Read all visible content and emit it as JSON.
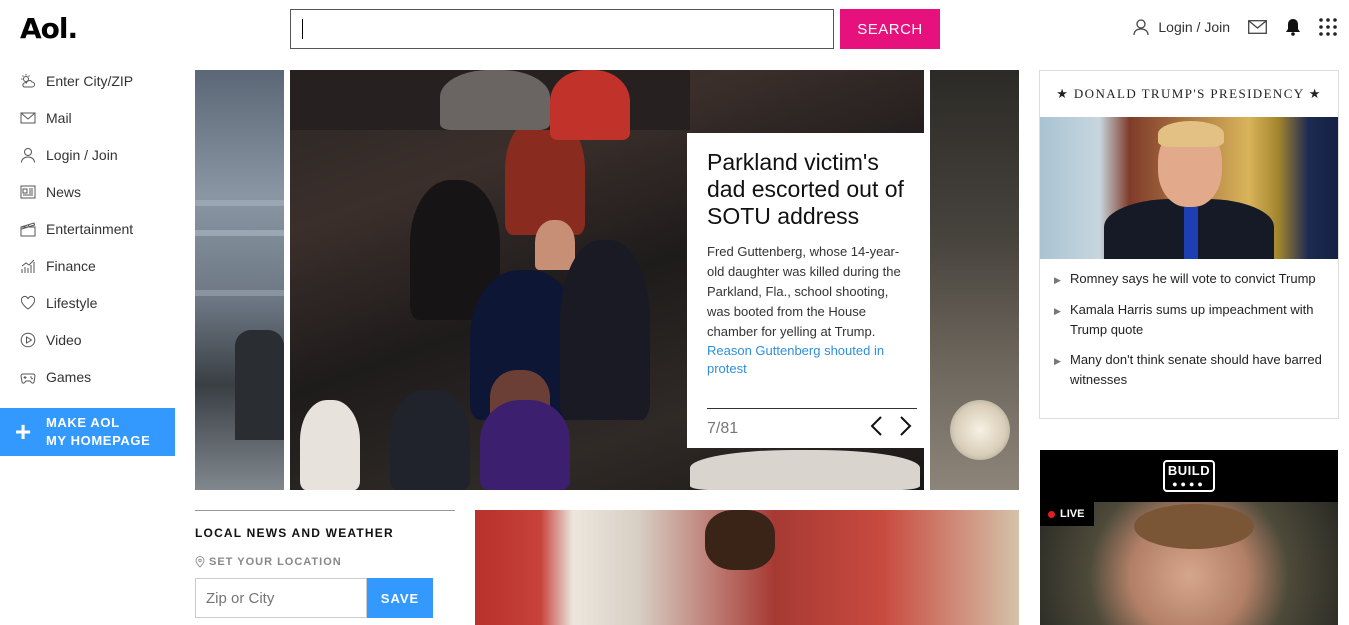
{
  "header": {
    "logo": "Aol.",
    "search_placeholder": "",
    "search_button": "SEARCH",
    "login_label": "Login / Join"
  },
  "leftnav": {
    "items": [
      {
        "label": "Enter City/ZIP",
        "icon": "weather-icon"
      },
      {
        "label": "Mail",
        "icon": "mail-icon"
      },
      {
        "label": "Login / Join",
        "icon": "user-icon"
      },
      {
        "label": "News",
        "icon": "news-icon"
      },
      {
        "label": "Entertainment",
        "icon": "clapperboard-icon"
      },
      {
        "label": "Finance",
        "icon": "chart-icon"
      },
      {
        "label": "Lifestyle",
        "icon": "heart-icon"
      },
      {
        "label": "Video",
        "icon": "play-icon"
      },
      {
        "label": "Games",
        "icon": "gamepad-icon"
      }
    ],
    "make_home_line1": "MAKE AOL",
    "make_home_line2": "MY HOMEPAGE"
  },
  "carousel": {
    "title": "Parkland victim's dad escorted out of SOTU address",
    "description": "Fred Guttenberg, whose 14-year-old daughter was killed during the Parkland, Fla., school shooting, was booted from the House chamber for yelling at Trump.",
    "link": "Reason Guttenberg shouted in protest",
    "counter": "7/81"
  },
  "local": {
    "title": "LOCAL NEWS AND WEATHER",
    "set_location": "SET YOUR LOCATION",
    "zip_placeholder": "Zip or City",
    "save_button": "SAVE"
  },
  "trump_box": {
    "header": "★ DONALD TRUMP'S PRESIDENCY ★",
    "headlines": [
      "Romney says he will vote to convict Trump",
      "Kamala Harris sums up impeachment with Trump quote",
      "Many don't think senate should have barred witnesses"
    ]
  },
  "build_box": {
    "logo": "BUILD",
    "live_label": "LIVE"
  },
  "colors": {
    "search_button": "#e6117d",
    "make_home": "#3399ff",
    "link": "#2e8fdc"
  }
}
